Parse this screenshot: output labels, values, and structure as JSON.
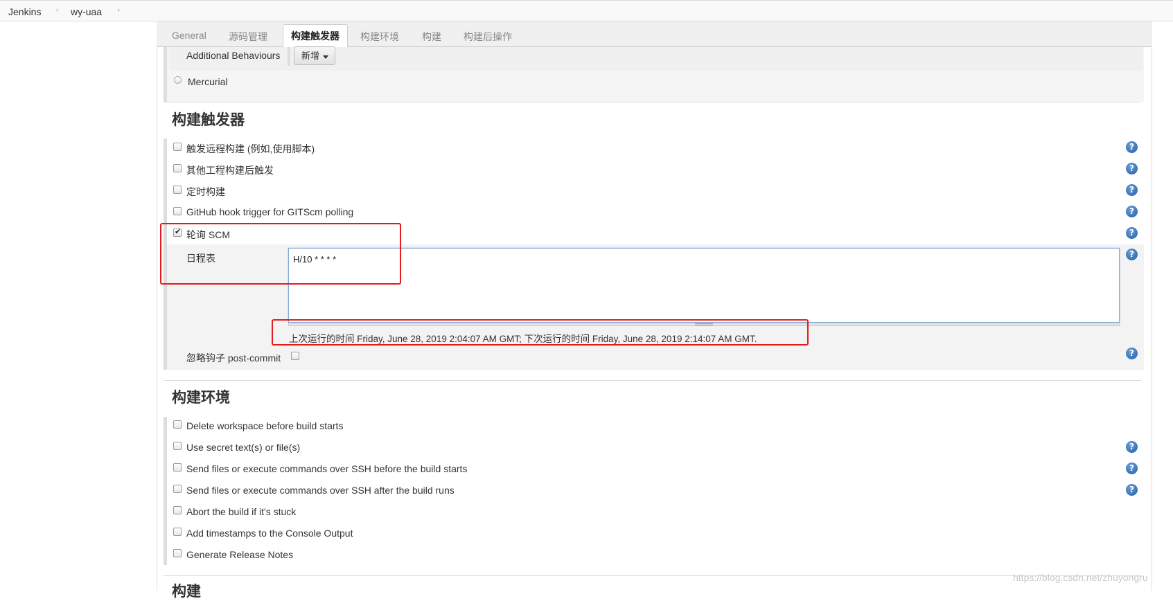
{
  "breadcrumb": {
    "items": [
      "Jenkins",
      "wy-uaa"
    ],
    "separator": "›"
  },
  "tabs": [
    {
      "label": "General",
      "active": false
    },
    {
      "label": "源码管理",
      "active": false
    },
    {
      "label": "构建触发器",
      "active": true
    },
    {
      "label": "构建环境",
      "active": false
    },
    {
      "label": "构建",
      "active": false
    },
    {
      "label": "构建后操作",
      "active": false
    }
  ],
  "scm": {
    "additional_behaviours_label": "Additional Behaviours",
    "add_button_label": "新增",
    "mercurial_label": "Mercurial"
  },
  "triggers": {
    "title": "构建触发器",
    "options": [
      {
        "label": "触发远程构建 (例如,使用脚本)",
        "checked": false
      },
      {
        "label": "其他工程构建后触发",
        "checked": false
      },
      {
        "label": "定时构建",
        "checked": false
      },
      {
        "label": "GitHub hook trigger for GITScm polling",
        "checked": false
      },
      {
        "label": "轮询 SCM",
        "checked": true
      }
    ],
    "schedule_label": "日程表",
    "schedule_value": "H/10 * * * *",
    "run_info": "上次运行的时间 Friday, June 28, 2019 2:04:07 AM GMT; 下次运行的时间 Friday, June 28, 2019 2:14:07 AM GMT.",
    "ignore_post_commit_label": "忽略钩子 post-commit",
    "ignore_post_commit_checked": false
  },
  "environment": {
    "title": "构建环境",
    "options": [
      {
        "label": "Delete workspace before build starts",
        "checked": false
      },
      {
        "label": "Use secret text(s) or file(s)",
        "checked": false
      },
      {
        "label": "Send files or execute commands over SSH before the build starts",
        "checked": false
      },
      {
        "label": "Send files or execute commands over SSH after the build runs",
        "checked": false
      },
      {
        "label": "Abort the build if it's stuck",
        "checked": false
      },
      {
        "label": "Add timestamps to the Console Output",
        "checked": false
      },
      {
        "label": "Generate Release Notes",
        "checked": false
      }
    ]
  },
  "build": {
    "title": "构建"
  },
  "help_glyph": "?",
  "watermark": "https://blog.csdn.net/zhuyongru",
  "colors": {
    "highlight": "#e8191c",
    "help_blue": "#1f5ea8"
  }
}
